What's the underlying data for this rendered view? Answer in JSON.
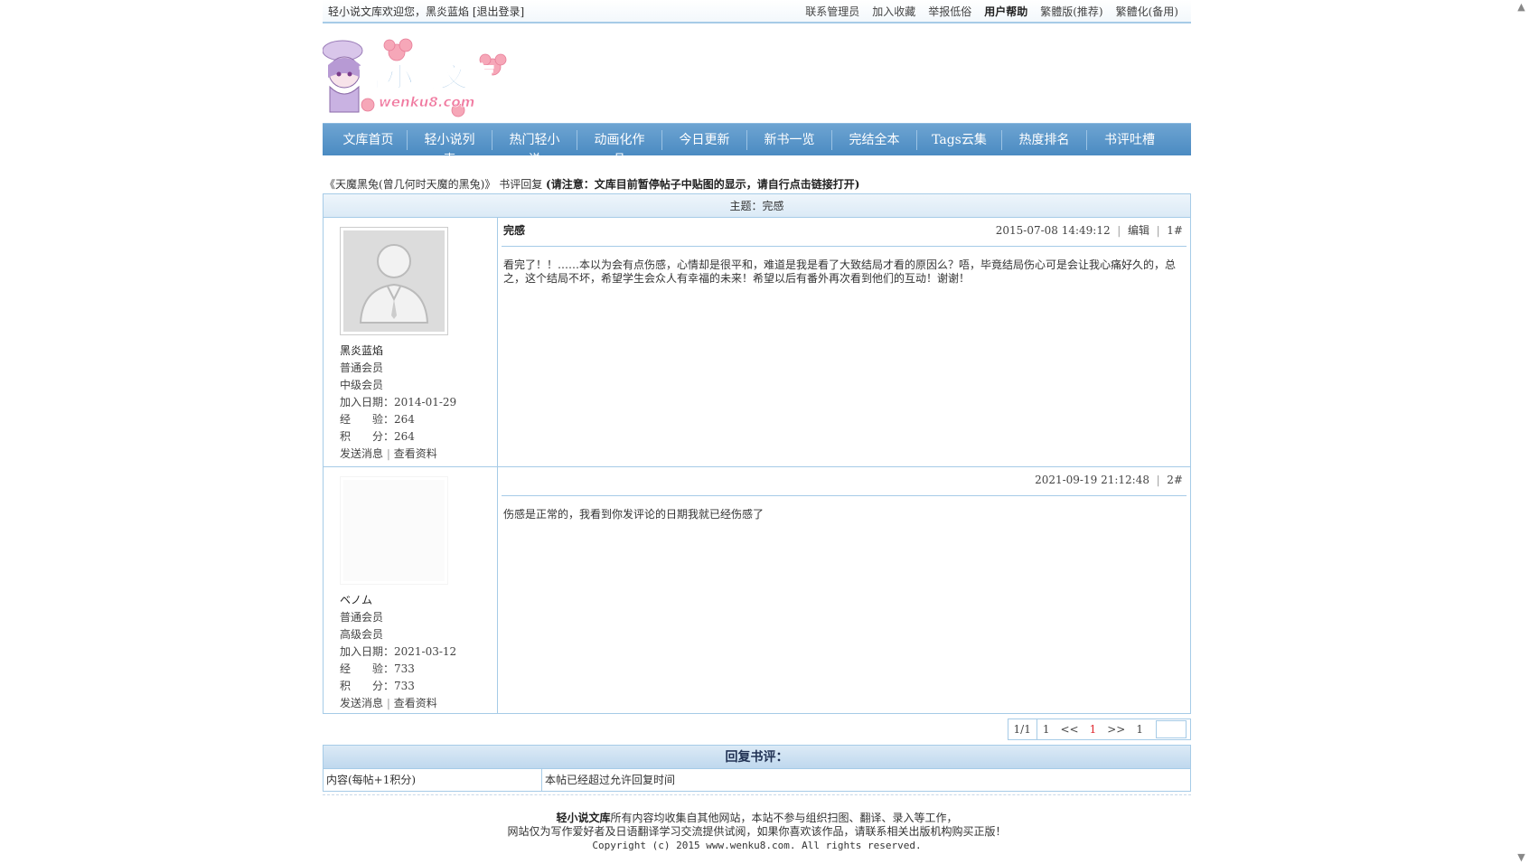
{
  "topbar": {
    "welcome": "轻小说文库欢迎您，黑炎蓝焰 [退出登录]",
    "links": [
      "联系管理员",
      "加入收藏",
      "举报低俗",
      "用户帮助",
      "繁體版(推荐)",
      "繁體化(备用)"
    ]
  },
  "logo": {
    "title": "輕小說文庫",
    "sub": "wenku8.com"
  },
  "nav": [
    "文库首页",
    "轻小说列表",
    "热门轻小说",
    "动画化作品",
    "今日更新",
    "新书一览",
    "完结全本",
    "Tags云集",
    "热度排名",
    "书评吐槽"
  ],
  "crumb": {
    "book": "《天魔黑兔(曾几何时天魔的黑兔)》",
    "section": "书评回复",
    "notice": "(请注意：文库目前暂停帖子中贴图的显示，请自行点击链接打开)"
  },
  "thread": {
    "title": "主题：完感"
  },
  "posts": [
    {
      "user": {
        "name": "黑炎蓝焰",
        "group": "普通会员",
        "level": "中级会员",
        "join": "加入日期：2014-01-29",
        "exp": "经　　验：264",
        "points": "积　　分：264",
        "send": "发送消息",
        "profile": "查看资料"
      },
      "title": "完感",
      "time": "2015-07-08 14:49:12",
      "edit": "编辑",
      "floor": "1#",
      "body": "看完了！！……本以为会有点伤感，心情却是很平和，难道是我是看了大致结局才看的原因么？唔，毕竟结局伤心可是会让我心痛好久的，总之，这个结局不坏，希望学生会众人有幸福的未来！希望以后有番外再次看到他们的互动！谢谢！"
    },
    {
      "user": {
        "name": "ベノム",
        "group": "普通会员",
        "level": "高级会员",
        "join": "加入日期：2021-03-12",
        "exp": "经　　验：733",
        "points": "积　　分：733",
        "send": "发送消息",
        "profile": "查看资料"
      },
      "title": "",
      "time": "2021-09-19 21:12:48",
      "floor": "2#",
      "body": "伤感是正常的，我看到你发评论的日期我就已经伤感了"
    }
  ],
  "pager": {
    "count": "1/1",
    "first": "1",
    "prev": "<<",
    "current": "1",
    "next": ">>",
    "last": "1"
  },
  "reply": {
    "title": "回复书评：",
    "label": "内容(每帖+1积分)",
    "message": "本帖已经超过允许回复时间"
  },
  "footer": {
    "site": "轻小说文库",
    "line1": "所有内容均收集自其他网站，本站不参与组织扫图、翻译、录入等工作，",
    "line2": "网站仅为写作爱好者及日语翻译学习交流提供试阅，如果你喜欢该作品，请联系相关出版机构购买正版！",
    "line3": "Copyright (c) 2015 www.wenku8.com. All rights reserved."
  }
}
